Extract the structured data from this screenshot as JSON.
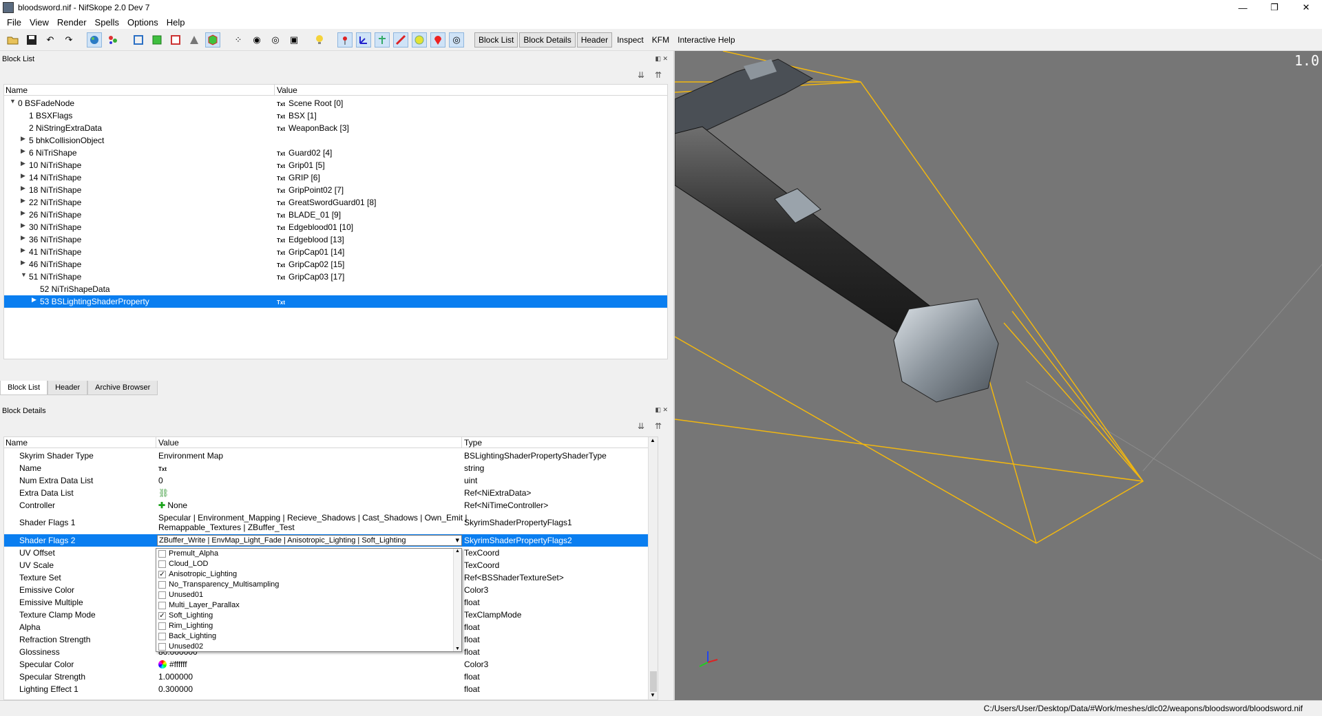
{
  "window": {
    "title": "bloodsword.nif - NifSkope 2.0 Dev 7",
    "minimize": "—",
    "maximize": "❐",
    "close": "✕"
  },
  "menu": [
    "File",
    "View",
    "Render",
    "Spells",
    "Options",
    "Help"
  ],
  "toolbar": {
    "text_buttons": [
      "Block List",
      "Block Details",
      "Header"
    ],
    "text_items": [
      "Inspect",
      "KFM",
      "Interactive Help"
    ]
  },
  "block_list": {
    "title": "Block List",
    "columns": [
      "Name",
      "Value"
    ],
    "txt_badge": "Txt",
    "rows": [
      {
        "name": "0 BSFadeNode",
        "value": "Scene Root [0]",
        "arrow": "down",
        "indent": 0
      },
      {
        "name": "1 BSXFlags",
        "value": "BSX [1]",
        "arrow": "",
        "indent": 1
      },
      {
        "name": "2 NiStringExtraData",
        "value": "WeaponBack [3]",
        "arrow": "",
        "indent": 1
      },
      {
        "name": "5 bhkCollisionObject",
        "value": "",
        "arrow": "right",
        "indent": 1
      },
      {
        "name": "6 NiTriShape",
        "value": "Guard02 [4]",
        "arrow": "right",
        "indent": 1
      },
      {
        "name": "10 NiTriShape",
        "value": "Grip01 [5]",
        "arrow": "right",
        "indent": 1
      },
      {
        "name": "14 NiTriShape",
        "value": "GRIP [6]",
        "arrow": "right",
        "indent": 1
      },
      {
        "name": "18 NiTriShape",
        "value": "GripPoint02 [7]",
        "arrow": "right",
        "indent": 1
      },
      {
        "name": "22 NiTriShape",
        "value": "GreatSwordGuard01 [8]",
        "arrow": "right",
        "indent": 1
      },
      {
        "name": "26 NiTriShape",
        "value": "BLADE_01 [9]",
        "arrow": "right",
        "indent": 1
      },
      {
        "name": "30 NiTriShape",
        "value": "Edgeblood01 [10]",
        "arrow": "right",
        "indent": 1
      },
      {
        "name": "36 NiTriShape",
        "value": "Edgeblood [13]",
        "arrow": "right",
        "indent": 1
      },
      {
        "name": "41 NiTriShape",
        "value": "GripCap01 [14]",
        "arrow": "right",
        "indent": 1
      },
      {
        "name": "46 NiTriShape",
        "value": "GripCap02 [15]",
        "arrow": "right",
        "indent": 1
      },
      {
        "name": "51 NiTriShape",
        "value": "GripCap03 [17]",
        "arrow": "down",
        "indent": 1
      },
      {
        "name": "52 NiTriShapeData",
        "value": "",
        "arrow": "",
        "indent": 2
      },
      {
        "name": "53 BSLightingShaderProperty",
        "value": "",
        "arrow": "right",
        "indent": 2,
        "selected": true,
        "badge_only": true
      }
    ]
  },
  "tabs": [
    "Block List",
    "Header",
    "Archive Browser"
  ],
  "block_details": {
    "title": "Block Details",
    "columns": [
      "Name",
      "Value",
      "Type"
    ],
    "rows": [
      {
        "name": "Skyrim Shader Type",
        "value": "Environment Map",
        "type": "BSLightingShaderPropertyShaderType"
      },
      {
        "name": "Name",
        "value": "",
        "type": "string",
        "badge": "Txt"
      },
      {
        "name": "Num Extra Data List",
        "value": "0",
        "type": "uint"
      },
      {
        "name": "Extra Data List",
        "value": "",
        "type": "Ref<NiExtraData>",
        "icon": "link"
      },
      {
        "name": "Controller",
        "value": "None",
        "type": "Ref<NiTimeController>",
        "icon": "plus"
      },
      {
        "name": "Shader Flags 1",
        "value": "Specular | Environment_Mapping | Recieve_Shadows | Cast_Shadows | Own_Emit |",
        "value2": "Remappable_Textures | ZBuffer_Test",
        "type": "SkyrimShaderPropertyFlags1",
        "tall": true
      },
      {
        "name": "Shader Flags 2",
        "value": "ZBuffer_Write | EnvMap_Light_Fade | Anisotropic_Lighting | Soft_Lighting",
        "type": "SkyrimShaderPropertyFlags2",
        "selected": true
      },
      {
        "name": "UV Offset",
        "value": "",
        "type": "TexCoord"
      },
      {
        "name": "UV Scale",
        "value": "",
        "type": "TexCoord"
      },
      {
        "name": "Texture Set",
        "value": "",
        "type": "Ref<BSShaderTextureSet>"
      },
      {
        "name": "Emissive Color",
        "value": "",
        "type": "Color3"
      },
      {
        "name": "Emissive Multiple",
        "value": "",
        "type": "float"
      },
      {
        "name": "Texture Clamp Mode",
        "value": "",
        "type": "TexClampMode"
      },
      {
        "name": "Alpha",
        "value": "",
        "type": "float"
      },
      {
        "name": "Refraction Strength",
        "value": "",
        "type": "float"
      },
      {
        "name": "Glossiness",
        "value": "80.000000",
        "type": "float"
      },
      {
        "name": "Specular Color",
        "value": "#ffffff",
        "type": "Color3",
        "icon": "wheel"
      },
      {
        "name": "Specular Strength",
        "value": "1.000000",
        "type": "float"
      },
      {
        "name": "Lighting Effect 1",
        "value": "0.300000",
        "type": "float"
      }
    ]
  },
  "dropdown": {
    "options": [
      {
        "label": "Premult_Alpha",
        "checked": false
      },
      {
        "label": "Cloud_LOD",
        "checked": false
      },
      {
        "label": "Anisotropic_Lighting",
        "checked": true
      },
      {
        "label": "No_Transparency_Multisampling",
        "checked": false
      },
      {
        "label": "Unused01",
        "checked": false
      },
      {
        "label": "Multi_Layer_Parallax",
        "checked": false
      },
      {
        "label": "Soft_Lighting",
        "checked": true
      },
      {
        "label": "Rim_Lighting",
        "checked": false
      },
      {
        "label": "Back_Lighting",
        "checked": false
      },
      {
        "label": "Unused02",
        "checked": false
      }
    ]
  },
  "viewport": {
    "zoom": "1.0",
    "background": "#767676",
    "bounds_color": "#f2b70f"
  },
  "status": {
    "path": "C:/Users/User/Desktop/Data/#Work/meshes/dlc02/weapons/bloodsword/bloodsword.nif"
  }
}
